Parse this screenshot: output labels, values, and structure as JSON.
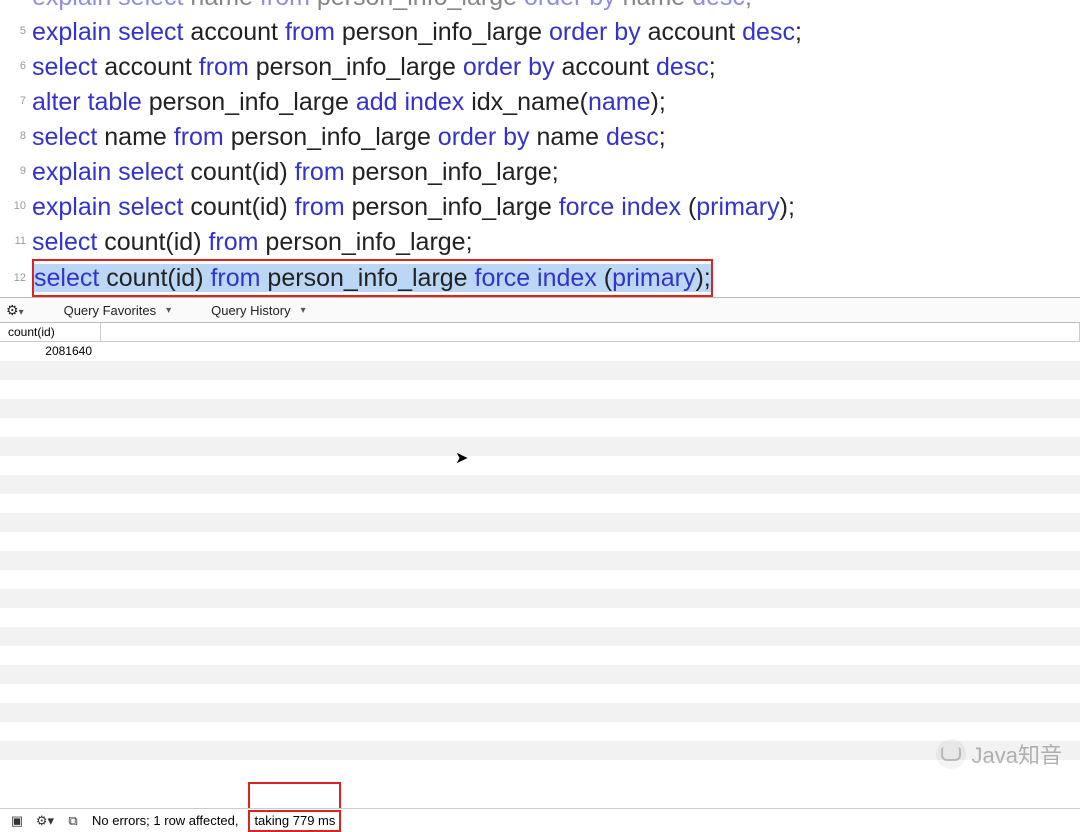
{
  "editor": {
    "highlight_line_index": 8,
    "lines": [
      {
        "num": "",
        "tokens": [
          {
            "t": "explain select",
            "c": "kw"
          },
          {
            "t": " name ",
            "c": ""
          },
          {
            "t": "from",
            "c": "kw"
          },
          {
            "t": " person_info_large ",
            "c": ""
          },
          {
            "t": "order by",
            "c": "kw"
          },
          {
            "t": " name ",
            "c": ""
          },
          {
            "t": "desc",
            "c": "kw"
          },
          {
            "t": ";",
            "c": ""
          }
        ]
      },
      {
        "num": "5",
        "tokens": [
          {
            "t": "explain select",
            "c": "kw"
          },
          {
            "t": " account ",
            "c": ""
          },
          {
            "t": "from",
            "c": "kw"
          },
          {
            "t": " person_info_large ",
            "c": ""
          },
          {
            "t": "order by",
            "c": "kw"
          },
          {
            "t": " account ",
            "c": ""
          },
          {
            "t": "desc",
            "c": "kw"
          },
          {
            "t": ";",
            "c": ""
          }
        ]
      },
      {
        "num": "6",
        "tokens": [
          {
            "t": "select",
            "c": "kw"
          },
          {
            "t": " account ",
            "c": ""
          },
          {
            "t": "from",
            "c": "kw"
          },
          {
            "t": " person_info_large ",
            "c": ""
          },
          {
            "t": "order by",
            "c": "kw"
          },
          {
            "t": " account ",
            "c": ""
          },
          {
            "t": "desc",
            "c": "kw"
          },
          {
            "t": ";",
            "c": ""
          }
        ]
      },
      {
        "num": "7",
        "tokens": [
          {
            "t": "alter table",
            "c": "kw"
          },
          {
            "t": " person_info_large ",
            "c": ""
          },
          {
            "t": "add index",
            "c": "kw"
          },
          {
            "t": " idx_name(",
            "c": ""
          },
          {
            "t": "name",
            "c": "fn"
          },
          {
            "t": ");",
            "c": ""
          }
        ]
      },
      {
        "num": "8",
        "tokens": [
          {
            "t": "select",
            "c": "kw"
          },
          {
            "t": " name ",
            "c": ""
          },
          {
            "t": "from",
            "c": "kw"
          },
          {
            "t": " person_info_large ",
            "c": ""
          },
          {
            "t": "order by",
            "c": "kw"
          },
          {
            "t": " name ",
            "c": ""
          },
          {
            "t": "desc",
            "c": "kw"
          },
          {
            "t": ";",
            "c": ""
          }
        ]
      },
      {
        "num": "9",
        "tokens": [
          {
            "t": "explain select",
            "c": "kw"
          },
          {
            "t": " count(id) ",
            "c": ""
          },
          {
            "t": "from",
            "c": "kw"
          },
          {
            "t": " person_info_large;",
            "c": ""
          }
        ]
      },
      {
        "num": "10",
        "tokens": [
          {
            "t": "explain select",
            "c": "kw"
          },
          {
            "t": " count(id) ",
            "c": ""
          },
          {
            "t": "from",
            "c": "kw"
          },
          {
            "t": " person_info_large ",
            "c": ""
          },
          {
            "t": "force index",
            "c": "kw"
          },
          {
            "t": " (",
            "c": ""
          },
          {
            "t": "primary",
            "c": "fn"
          },
          {
            "t": ");",
            "c": ""
          }
        ]
      },
      {
        "num": "11",
        "tokens": [
          {
            "t": "select",
            "c": "kw"
          },
          {
            "t": " count(id) ",
            "c": ""
          },
          {
            "t": "from",
            "c": "kw"
          },
          {
            "t": " person_info_large;",
            "c": ""
          }
        ]
      },
      {
        "num": "12",
        "tokens": [
          {
            "t": "select",
            "c": "kw"
          },
          {
            "t": " count(id) ",
            "c": ""
          },
          {
            "t": "from",
            "c": "kw"
          },
          {
            "t": " person_info_large ",
            "c": ""
          },
          {
            "t": "force index",
            "c": "kw"
          },
          {
            "t": " (",
            "c": ""
          },
          {
            "t": "primary",
            "c": "fn"
          },
          {
            "t": ");",
            "c": ""
          }
        ]
      }
    ]
  },
  "midbar": {
    "favorites_label": "Query Favorites",
    "history_label": "Query History"
  },
  "results": {
    "columns": [
      "count(id)"
    ],
    "rows": [
      [
        "2081640"
      ]
    ],
    "empty_row_count": 21
  },
  "status": {
    "message": "No errors; 1 row affected,",
    "timing": "taking 779 ms"
  },
  "watermark": {
    "text": "Java知音"
  }
}
